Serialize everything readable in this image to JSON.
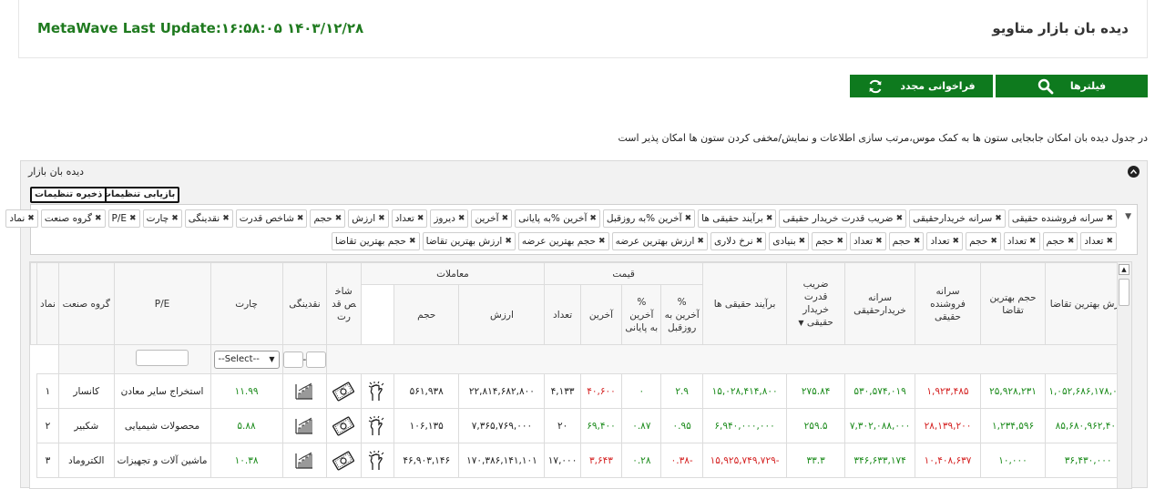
{
  "header": {
    "title": "دیده بان بازار متاویو",
    "last_update": "MetaWave Last Update:۱۶:۵۸:۰۵ ۱۴۰۳/۱۲/۲۸"
  },
  "toolbar": {
    "filters_label": "فیلترها",
    "reload_label": "فراخوانی مجدد"
  },
  "info_text": "در جدول دیده بان امکان جابجایی ستون ها به کمک موس،مرتب سازی اطلاعات و نمایش/مخفی کردن ستون ها امکان پذیر است",
  "panel": {
    "title": "دیده بان بازار",
    "restore_label": "بازیابی تنظیمات",
    "save_label": "ذخیره تنظیمات"
  },
  "tags_row1": [
    "سرانه فروشنده حقیقی",
    "سرانه خریدارحقیقی",
    "ضریب قدرت خریدار حقیقی",
    "برآیند حقیقی ها",
    "آخرین %به روزقبل",
    "آخرین %به پایانی",
    "آخرین",
    "دیروز",
    "تعداد",
    "ارزش",
    "حجم",
    "شاخص قدرت",
    "نقدینگی",
    "چارت",
    "P/E",
    "گروه صنعت",
    "نماد"
  ],
  "tags_row2": [
    "تعداد",
    "حجم",
    "تعداد",
    "حجم",
    "تعداد",
    "حجم",
    "تعداد",
    "حجم",
    "بنیادی",
    "نرخ دلاری",
    "ارزش بهترین عرضه",
    "حجم بهترین عرضه",
    "ارزش بهترین تقاضا",
    "حجم بهترین تقاضا"
  ],
  "table": {
    "group_headers": {
      "trades": "معاملات",
      "price": "قیمت"
    },
    "headers": {
      "namad": "نماد",
      "group": "گروه صنعت",
      "pe": "P/E",
      "chart": "چارت",
      "liquidity": "نقدینگی",
      "power": "شاخص قدرت",
      "volume": "حجم",
      "value": "ارزش",
      "count": "تعداد",
      "last": "آخرین",
      "last_close_pct": "% آخرین به پایانی",
      "last_prev_pct": "% آخرین به روزقبل",
      "net_real": "برآیند حقیقی ها",
      "real_buy_power": "ضریب قدرت خریدار حقیقی",
      "buyer_per_capita": "سرانه خریدارحقیقی",
      "seller_per_capita": "سرانه فروشنده حقیقی",
      "best_bid_vol": "حجم بهترین تقاضا",
      "best_bid_val": "ارزش بهترین تقاضا"
    },
    "filter": {
      "select_placeholder": "--Select--",
      "range_sep": "-"
    },
    "rows": [
      {
        "idx": "۱",
        "namad": "کانسار",
        "group": "استخراج سایر معادن",
        "pe": "۱۱.۹۹",
        "volume": "۵۶۱,۹۳۸",
        "value": "۲۲,۸۱۴,۶۸۲,۸۰۰",
        "count": "۴,۱۳۳",
        "last": "۴۰,۶۰۰",
        "last_close_pct": "۰",
        "last_prev_pct": "۲.۹",
        "net_real": "۱۵,۰۲۸,۴۱۴,۸۰۰",
        "real_buy_power": "۲۷۵.۸۴",
        "buyer_per_capita": "۵۳۰,۵۷۴,۰۱۹",
        "seller_per_capita": "۱,۹۲۳,۴۸۵",
        "best_bid_vol": "۲۵,۹۲۸,۲۳۱",
        "best_bid_val": "۱,۰۵۲,۶۸۶,۱۷۸,۰۰۰"
      },
      {
        "idx": "۲",
        "namad": "شکبیر",
        "group": "محصولات شیمیایی",
        "pe": "۵.۸۸",
        "volume": "۱۰۶,۱۳۵",
        "value": "۷,۳۶۵,۷۶۹,۰۰۰",
        "count": "۲۰",
        "last": "۶۹,۴۰۰",
        "last_close_pct": "۰.۸۷",
        "last_prev_pct": "۰.۹۵",
        "net_real": "۶,۹۴۰,۰۰۰,۰۰۰",
        "real_buy_power": "۲۵۹.۵",
        "buyer_per_capita": "۷,۳۰۲,۰۸۸,۰۰۰",
        "seller_per_capita": "۲۸,۱۳۹,۲۰۰",
        "best_bid_vol": "۱,۲۳۴,۵۹۶",
        "best_bid_val": "۸۵,۶۸۰,۹۶۲,۴۰۰"
      },
      {
        "idx": "۳",
        "namad": "الکتروماد",
        "group": "ماشین آلات و تجهیزات",
        "pe": "۱۰.۳۸",
        "volume": "۴۶,۹۰۳,۱۴۶",
        "value": "۱۷۰,۳۸۶,۱۴۱,۱۰۱",
        "count": "۱۷,۰۰۰",
        "last": "۳,۶۴۳",
        "last_close_pct": "۰.۲۸",
        "last_prev_pct": "-۰.۳۸",
        "net_real": "-۱۵,۹۲۵,۷۴۹,۷۲۹",
        "real_buy_power": "۳۳.۳",
        "buyer_per_capita": "۳۴۶,۶۳۳,۱۷۴",
        "seller_per_capita": "۱۰,۴۰۸,۶۳۷",
        "best_bid_vol": "۱۰,۰۰۰",
        "best_bid_val": "۳۶,۴۳۰,۰۰۰"
      }
    ]
  },
  "colors": {
    "accent": "#0e7a1e",
    "positive": "#1a8a1a",
    "negative": "#d42020"
  }
}
